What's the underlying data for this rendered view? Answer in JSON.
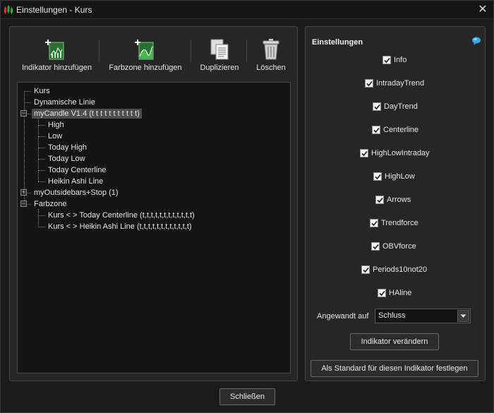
{
  "window": {
    "title": "Einstellungen - Kurs"
  },
  "toolbar": {
    "add_indicator": "Indikator hinzufügen",
    "add_colorzone": "Farbzone hinzufügen",
    "duplicate": "Duplizieren",
    "delete": "Löschen"
  },
  "tree": {
    "kurs": "Kurs",
    "dyn_line": "Dynamische Linie",
    "mycandle": "myCandle V1.4 (t t t t t t t t t t t)",
    "mycandle_children": [
      "High",
      "Low",
      "Today High",
      "Today Low",
      "Today Centerline",
      "Heikin Ashi Line"
    ],
    "myoutside": "myOutsidebars+Stop (1)",
    "farbzone": "Farbzone",
    "farbzone_children": [
      "Kurs < > Today Centerline (t,t,t,t,t,t,t,t,t,t,t,t)",
      "Kurs < > Heikin Ashi Line (t,t,t,t,t,t,t,t,t,t,t,t)"
    ]
  },
  "settings": {
    "title": "Einstellungen",
    "checkboxes": [
      {
        "label": "Info",
        "checked": true
      },
      {
        "label": "IntradayTrend",
        "checked": true
      },
      {
        "label": "DayTrend",
        "checked": true
      },
      {
        "label": "Centerline",
        "checked": true
      },
      {
        "label": "HighLowIntraday",
        "checked": true
      },
      {
        "label": "HighLow",
        "checked": true
      },
      {
        "label": "Arrows",
        "checked": true
      },
      {
        "label": "Trendforce",
        "checked": true
      },
      {
        "label": "OBVforce",
        "checked": true
      },
      {
        "label": "Periods10not20",
        "checked": true
      },
      {
        "label": "HAline",
        "checked": true
      }
    ],
    "applied_label": "Angewandt auf",
    "applied_value": "Schluss",
    "change_button": "Indikator verändern",
    "default_button": "Als Standard für diesen Indikator festlegen"
  },
  "footer": {
    "close_button": "Schließen"
  },
  "colors": {
    "background": "#1b1b1b",
    "panel": "#262626",
    "tree_bg": "#141414",
    "selection": "#4d4d4d",
    "icon_green": "#2faa3c",
    "info_blue": "#3aa8e8"
  }
}
